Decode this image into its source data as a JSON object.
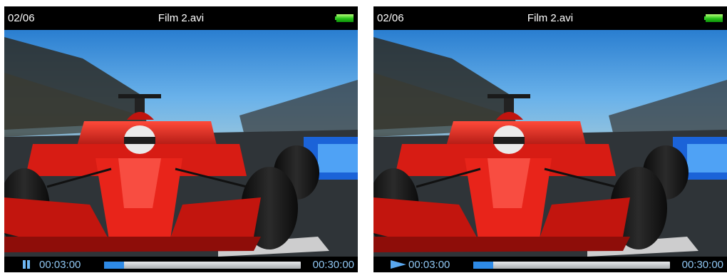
{
  "screens": [
    {
      "track_counter": "02/06",
      "file_name": "Film 2.avi",
      "playback_state_icon": "pause-icon",
      "elapsed_time": "00:03:00",
      "total_time": "00:30:00",
      "progress": 0.1,
      "accent_color": "#2e8ae6",
      "battery_color": "#27c21a"
    },
    {
      "track_counter": "02/06",
      "file_name": "Film 2.avi",
      "playback_state_icon": "play-icon",
      "elapsed_time": "00:03:00",
      "total_time": "00:30:00",
      "progress": 0.1,
      "accent_color": "#2e8ae6",
      "battery_color": "#27c21a"
    }
  ]
}
